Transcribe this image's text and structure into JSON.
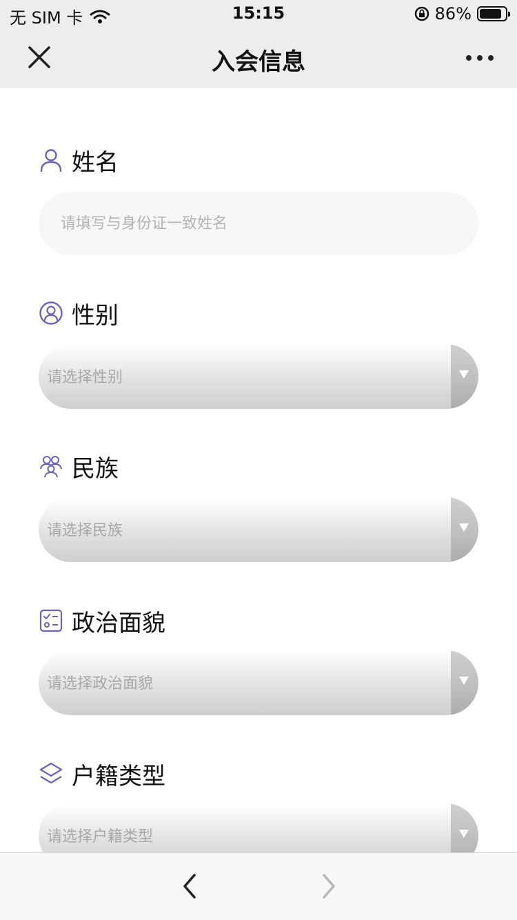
{
  "status_bar": {
    "carrier": "无 SIM 卡",
    "time": "15:15",
    "battery_percent": "86%",
    "battery_level": 0.86
  },
  "nav": {
    "title": "入会信息",
    "close_icon": "close-icon",
    "more_icon": "more-icon"
  },
  "form": {
    "name": {
      "label": "姓名",
      "icon": "person-icon",
      "placeholder": "请填写与身份证一致姓名"
    },
    "gender": {
      "label": "性别",
      "icon": "user-circle-icon",
      "placeholder": "请选择性别"
    },
    "ethnicity": {
      "label": "民族",
      "icon": "group-icon",
      "placeholder": "请选择民族"
    },
    "political_status": {
      "label": "政治面貌",
      "icon": "checklist-icon",
      "placeholder": "请选择政治面貌"
    },
    "household_type": {
      "label": "户籍类型",
      "icon": "layers-icon",
      "placeholder": "请选择户籍类型"
    }
  },
  "bottom_bar": {
    "back_icon": "chevron-left-icon",
    "forward_icon": "chevron-right-icon"
  },
  "colors": {
    "accent": "#6b63b5",
    "bar_bg": "#ededed"
  }
}
